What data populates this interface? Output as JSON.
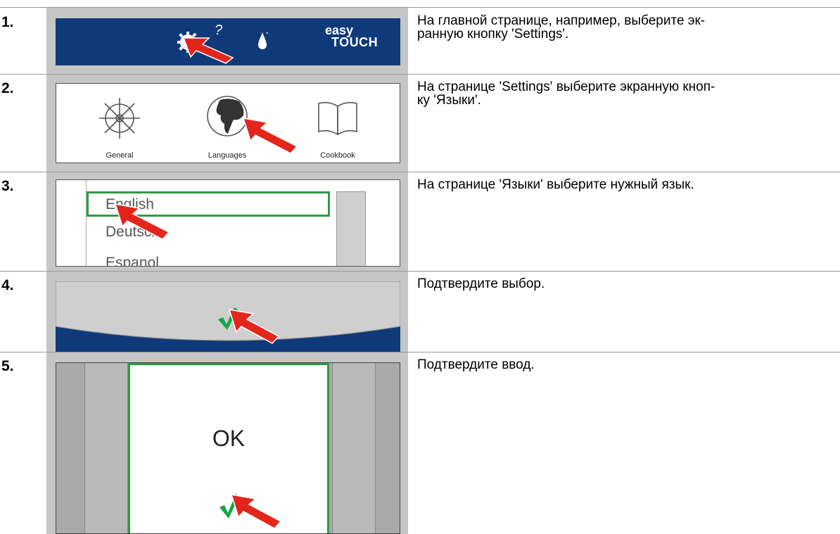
{
  "steps": [
    {
      "number": "1.",
      "text": "На главной странице, например, выберите эк-ранную кнопку 'Settings'.",
      "text_lines": [
        "На главной странице, например, выберите эк-",
        "ранную кнопку 'Settings'."
      ],
      "screen": {
        "brand_top": "easy",
        "brand_bottom": "TOUCH",
        "bar_color": "#0f3a7a"
      }
    },
    {
      "number": "2.",
      "text_lines": [
        "На странице 'Settings' выберите экранную кноп-",
        "ку 'Языки'."
      ],
      "screen": {
        "labels": [
          "General",
          "Languages",
          "Cookbook"
        ]
      }
    },
    {
      "number": "3.",
      "text_lines": [
        "На странице 'Языки' выберите нужный язык."
      ],
      "screen": {
        "languages": [
          "English",
          "Deutsch",
          "Espanol"
        ],
        "selected": "English",
        "highlight_color": "#2e9b47"
      }
    },
    {
      "number": "4.",
      "text_lines": [
        "Подтвердите выбор."
      ],
      "screen": {
        "icon": "checkmark-icon"
      }
    },
    {
      "number": "5.",
      "text_lines": [
        "Подтвердите ввод."
      ],
      "screen": {
        "button_text": "OK",
        "icon": "checkmark-icon"
      }
    }
  ],
  "colors": {
    "arrow": "#e2261c",
    "check_green": "#16a548",
    "frame_blue": "#0f3a7a"
  }
}
